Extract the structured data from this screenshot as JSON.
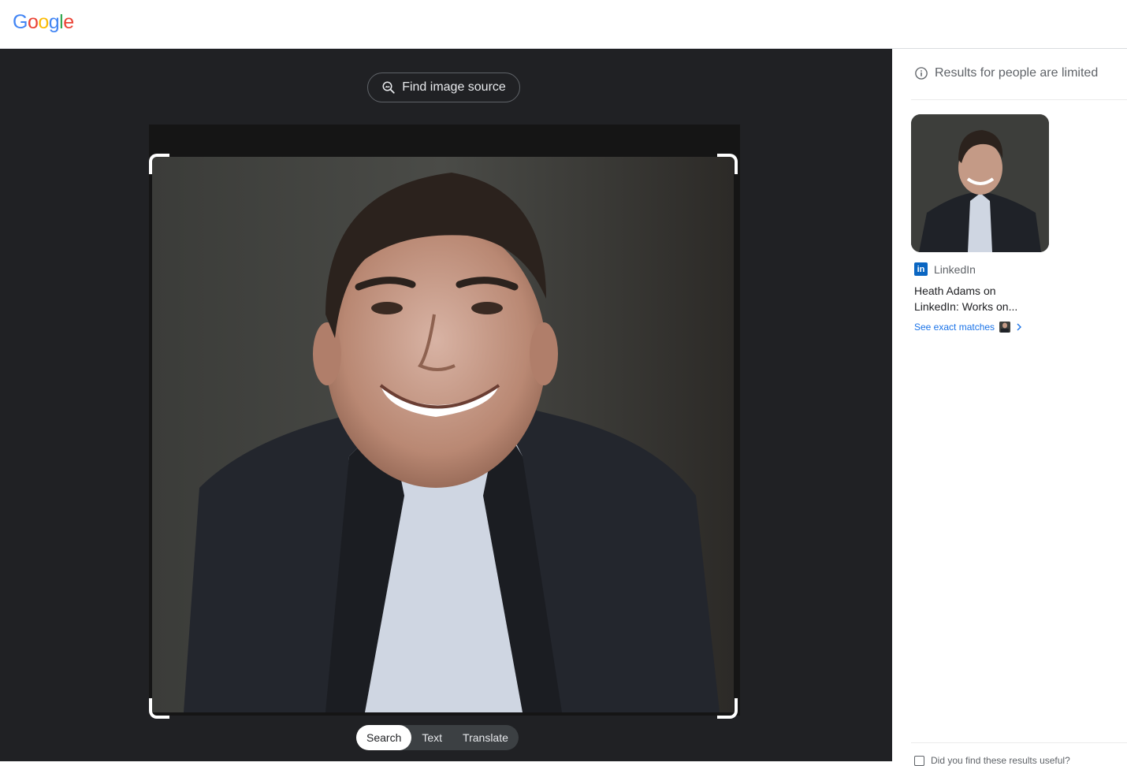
{
  "header": {
    "logo_letters": [
      "G",
      "o",
      "o",
      "g",
      "l",
      "e"
    ],
    "logo_colors": [
      "#4285F4",
      "#EA4335",
      "#FBBC05",
      "#4285F4",
      "#34A853",
      "#EA4335"
    ]
  },
  "lens": {
    "find_source_label": "Find image source",
    "tabs": [
      {
        "label": "Search",
        "active": true
      },
      {
        "label": "Text",
        "active": false
      },
      {
        "label": "Translate",
        "active": false
      }
    ]
  },
  "results": {
    "notice": "Results for people are limited",
    "source_name": "LinkedIn",
    "source_icon": "in",
    "title": "Heath Adams on LinkedIn: Works on...",
    "exact_matches_label": "See exact matches",
    "feedback_text": "Did you find these results useful?"
  },
  "colors": {
    "panel_dark": "#202124",
    "accent_link": "#1a73e8",
    "linkedin_blue": "#0a66c2"
  }
}
